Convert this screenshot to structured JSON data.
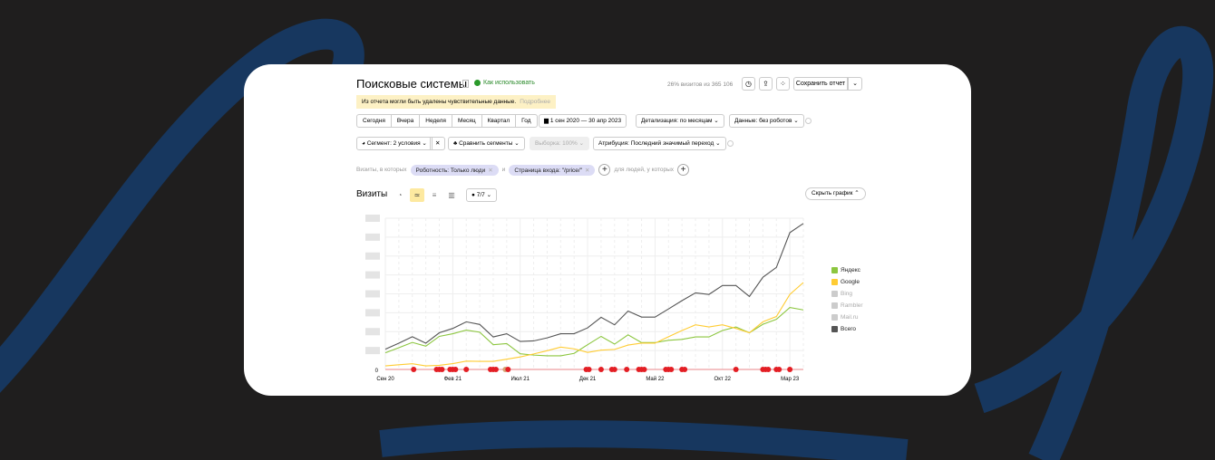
{
  "header": {
    "title": "Поисковые системы",
    "how_to_use": "Как использовать",
    "visits_stat": "26% визитов из 365 106",
    "save_report": "Сохранить отчет"
  },
  "warning": {
    "text": "Из отчета могли быть удалены чувствительные данные.",
    "more": "Подробнее"
  },
  "periods": [
    "Сегодня",
    "Вчера",
    "Неделя",
    "Месяц",
    "Квартал",
    "Год"
  ],
  "date_range": "1 сен 2020 — 30 апр 2023",
  "detail": "Детализация: по месяцам",
  "data_filter": "Данные: без роботов",
  "segment": "Сегмент: 2 условия",
  "compare": "Сравнить сегменты",
  "sample": "Выборка: 100%",
  "attribution": "Атрибуция: Последний значимый переход",
  "filters": {
    "prefix": "Визиты, в которых",
    "chip1": "Роботность: Только люди",
    "and": "и",
    "chip2": "Страница входа: \"/price/\"",
    "people": "для людей, у которых"
  },
  "chart_header": {
    "title": "Визиты",
    "annotations": "7/7",
    "hide_chart": "Скрыть график"
  },
  "colors": {
    "yandex": "#8cc63f",
    "google": "#ffcc33",
    "total": "#555555",
    "annotation": "#e31e24",
    "bg_swoosh": "#17375f"
  },
  "chart_data": {
    "type": "line",
    "x": [
      "Сен 20",
      "Окт 20",
      "Ноя 20",
      "Дек 20",
      "Янв 21",
      "Фев 21",
      "Мар 21",
      "Апр 21",
      "Май 21",
      "Июн 21",
      "Июл 21",
      "Авг 21",
      "Сен 21",
      "Окт 21",
      "Ноя 21",
      "Дек 21",
      "Янв 22",
      "Фев 22",
      "Мар 22",
      "Апр 22",
      "Май 22",
      "Июн 22",
      "Июл 22",
      "Авг 22",
      "Сен 22",
      "Окт 22",
      "Ноя 22",
      "Дек 22",
      "Янв 23",
      "Фев 23",
      "Мар 23",
      "Апр 23"
    ],
    "x_tick_labels": [
      {
        "i": 0,
        "label": "Сен 20"
      },
      {
        "i": 5,
        "label": "Фев 21"
      },
      {
        "i": 10,
        "label": "Июл 21"
      },
      {
        "i": 15,
        "label": "Дек 21"
      },
      {
        "i": 20,
        "label": "Май 22"
      },
      {
        "i": 25,
        "label": "Окт 22"
      },
      {
        "i": 30,
        "label": "Мар 23"
      }
    ],
    "y_zero_label": "0",
    "ylim": [
      0,
      8
    ],
    "grid": true,
    "legend": "right",
    "series": [
      {
        "name": "Яндекс",
        "color": "#8cc63f",
        "checked": true,
        "values": [
          0.88,
          1.15,
          1.43,
          1.23,
          1.75,
          1.89,
          2.08,
          1.97,
          1.31,
          1.37,
          0.83,
          0.76,
          0.72,
          0.72,
          0.85,
          1.31,
          1.75,
          1.34,
          1.83,
          1.42,
          1.42,
          1.54,
          1.59,
          1.72,
          1.72,
          2.06,
          2.25,
          1.94,
          2.39,
          2.65,
          3.28,
          3.15
        ]
      },
      {
        "name": "Google",
        "color": "#ffcc33",
        "checked": true,
        "values": [
          0.19,
          0.25,
          0.3,
          0.19,
          0.22,
          0.31,
          0.44,
          0.43,
          0.43,
          0.54,
          0.66,
          0.82,
          0.99,
          1.18,
          1.09,
          0.9,
          1.02,
          1.06,
          1.29,
          1.39,
          1.39,
          1.73,
          2.06,
          2.36,
          2.25,
          2.36,
          2.17,
          1.94,
          2.52,
          2.8,
          3.97,
          4.6
        ]
      },
      {
        "name": "Bing",
        "color": "#cccccc",
        "checked": false,
        "values": []
      },
      {
        "name": "Rambler",
        "color": "#cccccc",
        "checked": false,
        "values": []
      },
      {
        "name": "Mail.ru",
        "color": "#cccccc",
        "checked": false,
        "values": []
      },
      {
        "name": "Всего",
        "color": "#555555",
        "checked": true,
        "values": [
          1.07,
          1.39,
          1.73,
          1.39,
          1.94,
          2.17,
          2.52,
          2.38,
          1.72,
          1.89,
          1.48,
          1.51,
          1.67,
          1.89,
          1.89,
          2.2,
          2.76,
          2.36,
          3.09,
          2.77,
          2.77,
          3.2,
          3.64,
          4.05,
          3.97,
          4.44,
          4.44,
          3.86,
          4.88,
          5.4,
          7.24,
          7.72
        ]
      }
    ],
    "annotation_months": [
      2.1,
      3.8,
      4,
      4.2,
      4.8,
      5,
      5.2,
      6,
      7.8,
      8,
      8.2,
      8.9,
      9.1,
      14.9,
      15.1,
      16,
      16.8,
      17,
      17.9,
      18.8,
      19,
      19.2,
      20.8,
      21,
      21.2,
      22,
      22.2,
      26,
      28,
      28.2,
      28.4,
      29,
      29.2,
      30
    ]
  }
}
